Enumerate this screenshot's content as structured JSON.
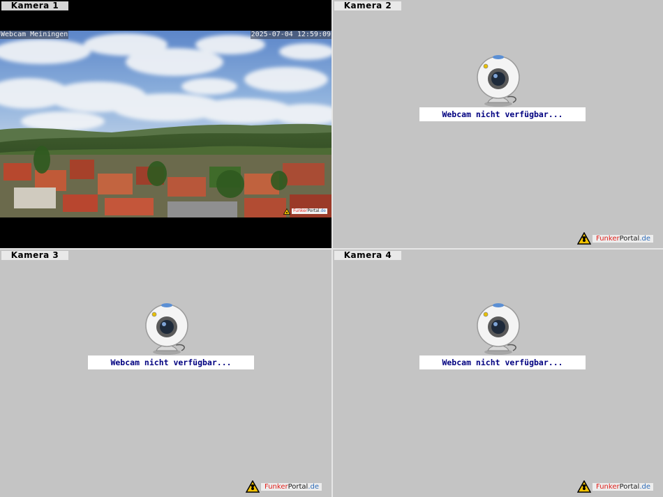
{
  "cameras": [
    {
      "label": "Kamera 1",
      "status": "live",
      "overlay_name": "Webcam Meiningen",
      "overlay_time": "2025-07-04 12:59:09"
    },
    {
      "label": "Kamera 2",
      "status": "unavailable",
      "message": "Webcam nicht verfügbar..."
    },
    {
      "label": "Kamera 3",
      "status": "unavailable",
      "message": "Webcam nicht verfügbar..."
    },
    {
      "label": "Kamera 4",
      "status": "unavailable",
      "message": "Webcam nicht verfügbar..."
    }
  ],
  "brand": {
    "part1": "Funk",
    "part2": "er",
    "part3": "Portal",
    "part4": ".de"
  },
  "colors": {
    "panel_bg": "#c4c4c4",
    "message_text": "#000080",
    "brand_red": "#e0201b",
    "brand_blue": "#2c6bb8"
  },
  "icons": [
    "webcam-icon",
    "radiation-warning-icon"
  ]
}
